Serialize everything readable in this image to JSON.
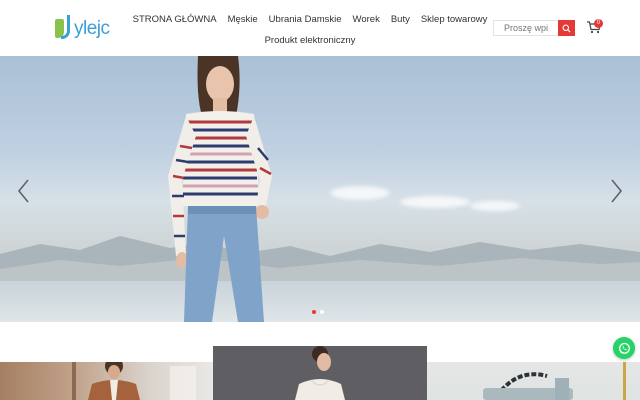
{
  "brand": {
    "logo_text": "ylejc"
  },
  "nav": {
    "row1": [
      "STRONA GŁÓWNA",
      "Męskie",
      "Ubrania Damskie",
      "Worek",
      "Buty",
      "Sklep towarowy"
    ],
    "row2": [
      "Produkt elektroniczny"
    ]
  },
  "search": {
    "placeholder": "Proszę wpi"
  },
  "cart": {
    "count": "0",
    "icon": "cart-icon"
  },
  "hero": {
    "slide_count": 2,
    "active_slide": 1
  },
  "colors": {
    "accent": "#e53935",
    "brand_blue": "#3aa0d8",
    "brand_green": "#8bc34a",
    "whatsapp": "#25d366"
  },
  "icons": [
    "search-icon",
    "cart-icon",
    "chevron-left-icon",
    "chevron-right-icon",
    "whatsapp-icon"
  ]
}
